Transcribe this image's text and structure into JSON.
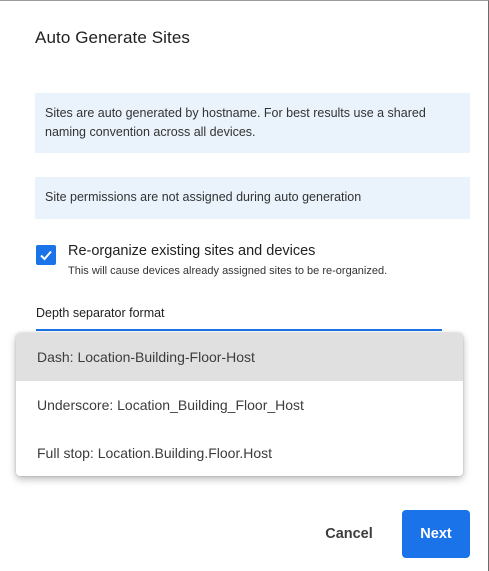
{
  "dialog": {
    "title": "Auto Generate Sites",
    "info_naming": "Sites are auto generated by hostname. For best results use a shared naming convention across all devices.",
    "info_permissions": "Site permissions are not assigned during auto generation"
  },
  "reorganize": {
    "checked": true,
    "label": "Re-organize existing sites and devices",
    "help": "This will cause devices already assigned sites to be re-organized."
  },
  "depth_separator": {
    "label": "Depth separator format",
    "options": [
      {
        "label": "Dash: Location-Building-Floor-Host",
        "selected": true
      },
      {
        "label": "Underscore: Location_Building_Floor_Host",
        "selected": false
      },
      {
        "label": "Full stop: Location.Building.Floor.Host",
        "selected": false
      }
    ]
  },
  "actions": {
    "cancel_label": "Cancel",
    "next_label": "Next"
  },
  "colors": {
    "accent": "#1a73e8",
    "info_background": "#eaf2fb",
    "selected_option": "#e0e0e0"
  }
}
